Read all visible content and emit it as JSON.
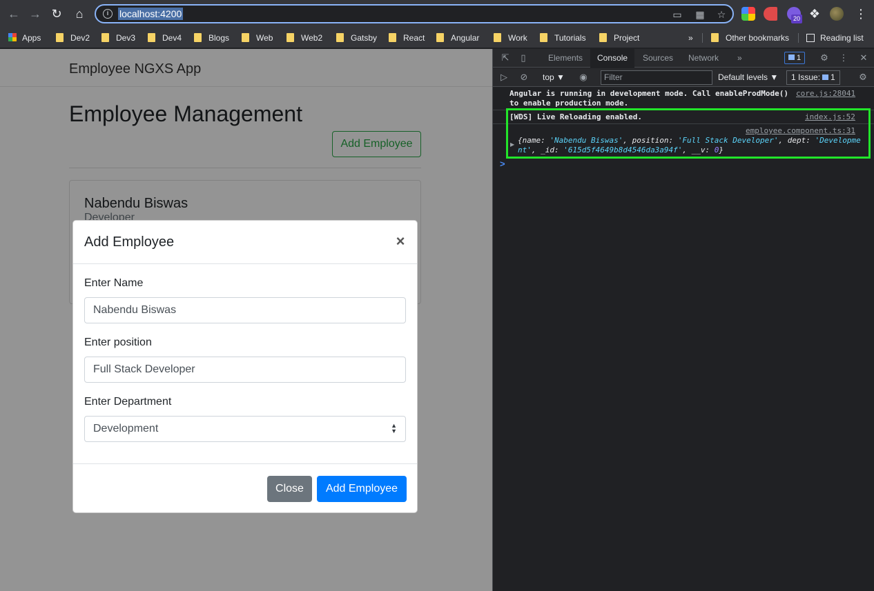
{
  "browser": {
    "url": "localhost:4200",
    "ext_badge": "20",
    "bookmarks": [
      "Apps",
      "Dev2",
      "Dev3",
      "Dev4",
      "Blogs",
      "Web",
      "Web2",
      "Gatsby",
      "React",
      "Angular",
      "Work",
      "Tutorials",
      "Project"
    ],
    "overflow": "»",
    "other_bookmarks": "Other bookmarks",
    "reading_list": "Reading list"
  },
  "page": {
    "brand": "Employee NGXS App",
    "heading": "Employee Management",
    "add_button": "Add Employee",
    "card": {
      "name": "Nabendu Biswas",
      "position": "Developer"
    }
  },
  "modal": {
    "title": "Add Employee",
    "close_glyph": "×",
    "name_label": "Enter Name",
    "name_value": "Nabendu Biswas",
    "position_label": "Enter position",
    "position_value": "Full Stack Developer",
    "dept_label": "Enter Department",
    "dept_value": "Development",
    "close_button": "Close",
    "submit_button": "Add Employee"
  },
  "devtools": {
    "tabs": [
      "Elements",
      "Console",
      "Sources",
      "Network"
    ],
    "active_tab": "Console",
    "more": "»",
    "msg_count": "1",
    "context": "top ▼",
    "filter_placeholder": "Filter",
    "levels": "Default levels ▼",
    "issues": "1 Issue:",
    "issues_count": "1",
    "messages": [
      {
        "text": "Angular is running in development mode. Call enableProdMode()\nto enable production mode.",
        "source": "core.js:28041"
      },
      {
        "text": "[WDS] Live Reloading enabled.",
        "source": "index.js:52"
      },
      {
        "source": "employee.component.ts:31"
      }
    ],
    "log_object": {
      "k1": "{name: ",
      "v1": "'Nabendu Biswas'",
      "k2": ", position: ",
      "v2": "'Full Stack Developer'",
      "k3": ", dept: ",
      "v3": "'Developme",
      "v3b": "nt'",
      "k4": ", _id: ",
      "v4": "'615d5f4649b8d4546da3a94f'",
      "k5": ", __v: ",
      "v5": "0",
      "k6": "}"
    },
    "prompt": ">"
  }
}
